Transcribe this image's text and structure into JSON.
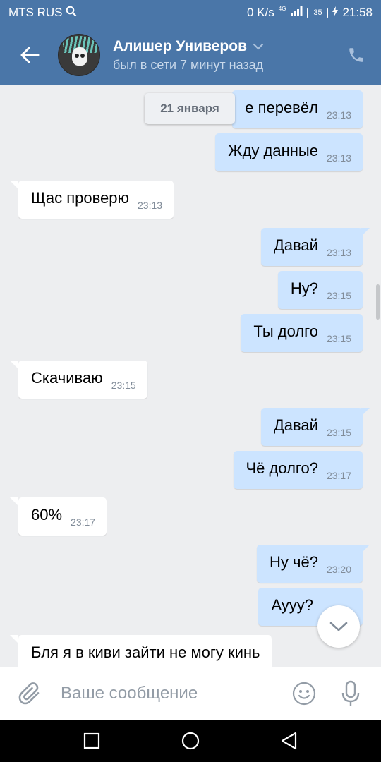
{
  "status_bar": {
    "carrier": "MTS RUS",
    "network_speed": "0 K/s",
    "network_type": "4G",
    "battery": "35",
    "time": "21:58"
  },
  "header": {
    "contact_name": "Алишер Универов",
    "last_seen": "был в сети 7 минут назад",
    "icons": [
      "back-arrow-icon",
      "chevron-down-icon",
      "phone-icon"
    ]
  },
  "chat": {
    "date_divider": "21 января",
    "messages": [
      {
        "direction": "out",
        "text": "е перевёл",
        "time": "23:13"
      },
      {
        "direction": "out",
        "text": "Жду данные",
        "time": "23:13"
      },
      {
        "direction": "in",
        "text": "Щас проверю",
        "time": "23:13"
      },
      {
        "direction": "out",
        "text": "Давай",
        "time": "23:13"
      },
      {
        "direction": "out",
        "text": "Ну?",
        "time": "23:15"
      },
      {
        "direction": "out",
        "text": "Ты долго",
        "time": "23:15"
      },
      {
        "direction": "in",
        "text": "Скачиваю",
        "time": "23:15"
      },
      {
        "direction": "out",
        "text": "Давай",
        "time": "23:15"
      },
      {
        "direction": "out",
        "text": "Чё долго?",
        "time": "23:17"
      },
      {
        "direction": "in",
        "text": "60%",
        "time": "23:17"
      },
      {
        "direction": "out",
        "text": "Ну чё?",
        "time": "23:20"
      },
      {
        "direction": "out",
        "text": "Ayyy?",
        "time": ""
      },
      {
        "direction": "in",
        "text": "Бля я в киви зайти не могу кинь",
        "time": ""
      }
    ]
  },
  "composer": {
    "placeholder": "Ваше сообщение",
    "icons": [
      "paperclip-icon",
      "emoji-icon",
      "microphone-icon"
    ]
  },
  "nav_bar": {
    "icons": [
      "recent-apps-icon",
      "home-icon",
      "back-icon"
    ]
  },
  "colors": {
    "header_bg": "#4a76a8",
    "chat_bg": "#edeef0",
    "outgoing_bubble": "#cce4ff",
    "incoming_bubble": "#ffffff"
  }
}
